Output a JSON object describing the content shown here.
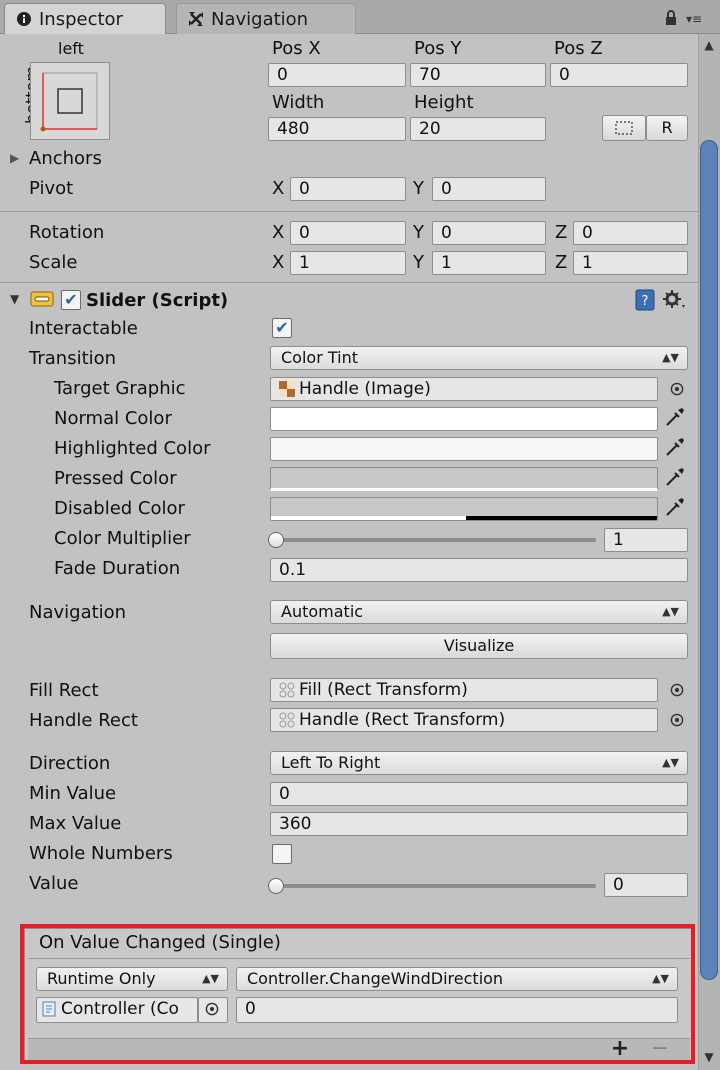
{
  "tabs": {
    "inspector": "Inspector",
    "navigation": "Navigation"
  },
  "rect": {
    "anchor_top_label": "left",
    "anchor_side_label": "bottom",
    "pos_x_label": "Pos X",
    "pos_y_label": "Pos Y",
    "pos_z_label": "Pos Z",
    "pos_x": "0",
    "pos_y": "70",
    "pos_z": "0",
    "width_label": "Width",
    "height_label": "Height",
    "width": "480",
    "height": "20",
    "raw_button": "R",
    "anchors_label": "Anchors",
    "pivot_label": "Pivot",
    "pivot_x": "0",
    "pivot_y": "0",
    "rotation_label": "Rotation",
    "rot_x": "0",
    "rot_y": "0",
    "rot_z": "0",
    "scale_label": "Scale",
    "scale_x": "1",
    "scale_y": "1",
    "scale_z": "1",
    "axis_x": "X",
    "axis_y": "Y",
    "axis_z": "Z"
  },
  "slider": {
    "title": "Slider (Script)",
    "interactable_label": "Interactable",
    "interactable_checked": "✔",
    "transition_label": "Transition",
    "transition_value": "Color Tint",
    "target_graphic_label": "Target Graphic",
    "target_graphic_value": "Handle (Image)",
    "normal_color_label": "Normal Color",
    "highlighted_color_label": "Highlighted Color",
    "pressed_color_label": "Pressed Color",
    "disabled_color_label": "Disabled Color",
    "color_multiplier_label": "Color Multiplier",
    "color_multiplier_value": "1",
    "fade_duration_label": "Fade Duration",
    "fade_duration_value": "0.1",
    "navigation_label": "Navigation",
    "navigation_value": "Automatic",
    "visualize_label": "Visualize",
    "fill_rect_label": "Fill Rect",
    "fill_rect_value": "Fill (Rect Transform)",
    "handle_rect_label": "Handle Rect",
    "handle_rect_value": "Handle (Rect Transform)",
    "direction_label": "Direction",
    "direction_value": "Left To Right",
    "min_value_label": "Min Value",
    "min_value": "0",
    "max_value_label": "Max Value",
    "max_value": "360",
    "whole_numbers_label": "Whole Numbers",
    "value_label": "Value",
    "value": "0"
  },
  "event": {
    "title": "On Value Changed (Single)",
    "runtime_value": "Runtime Only",
    "function_value": "Controller.ChangeWindDirection",
    "object_value": "Controller (Co",
    "argument_value": "0",
    "add_label": "+",
    "remove_label": "−"
  },
  "colors": {
    "scroll_thumb": "#5c82b8",
    "highlight_border": "#e01f27",
    "checkbox_blue": "#2c62a8"
  }
}
